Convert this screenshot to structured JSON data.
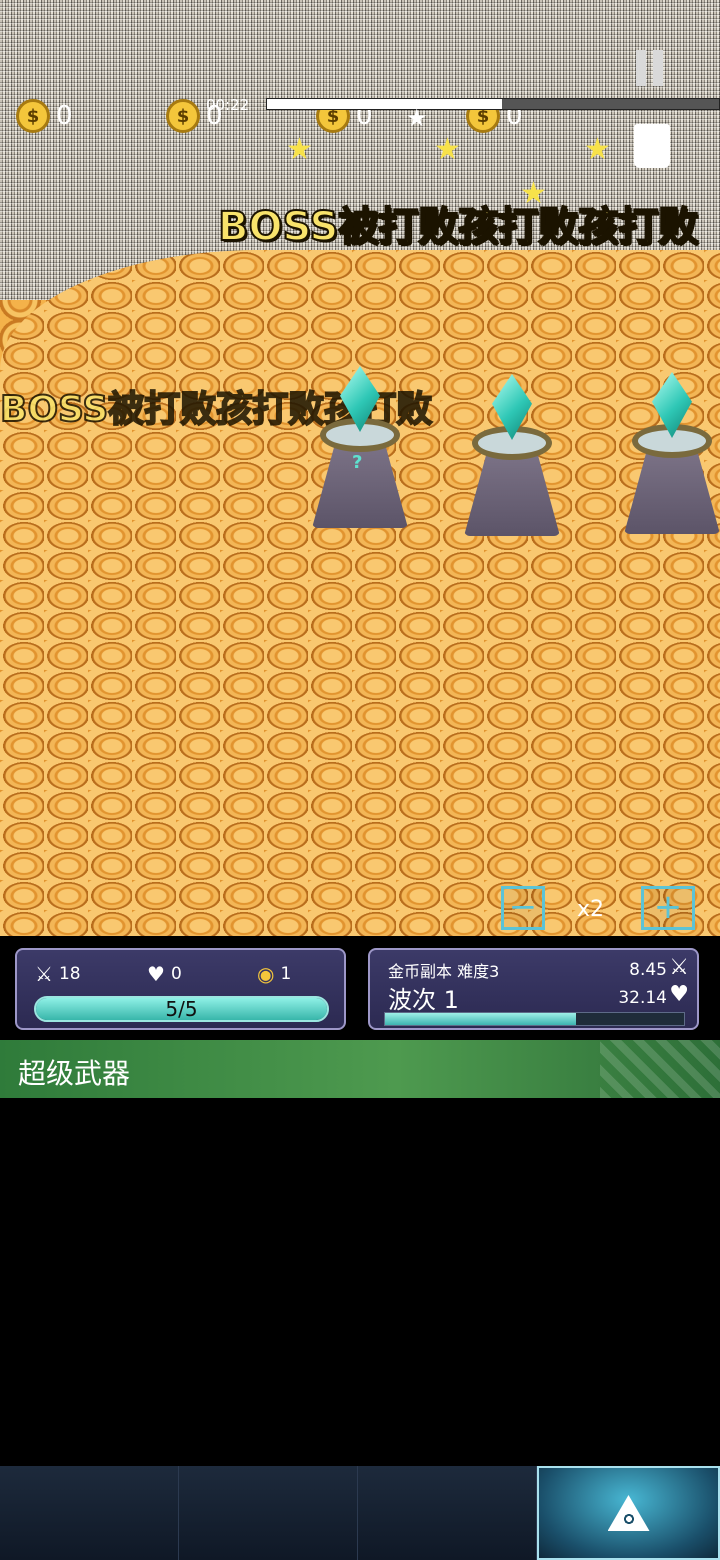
{
  "game": {
    "coin_counters": [
      "0",
      "0",
      "0",
      "0"
    ],
    "timer": "00:22",
    "boss_banner": "BOSS被打败孩打败孩打败",
    "speed_label": "x2",
    "zoom_out_label": "−",
    "zoom_in_label": "+",
    "tower_mark": "?",
    "top_bar_progress": 0.52
  },
  "left_panel": {
    "attack": "18",
    "lives_lost": "0",
    "coins": "1",
    "life_text": "5/5",
    "life_fraction": 1.0
  },
  "right_panel": {
    "dungeon": "金币副本 难度3",
    "wave": "波次 1",
    "damage": "8.45",
    "health": "32.14",
    "wave_fraction": 0.64
  },
  "weapon_section": {
    "title": "超级武器"
  },
  "nav": {
    "tabs": [
      "tab-1",
      "tab-2",
      "tab-3",
      "tab-4"
    ],
    "active_icon": "eye-triangle-icon"
  },
  "colors": {
    "accent_teal": "#5cc3d6",
    "coin_gold": "#f4c63b",
    "panel_bg": "#3c3a68",
    "header_green": "#4e9a4f"
  }
}
